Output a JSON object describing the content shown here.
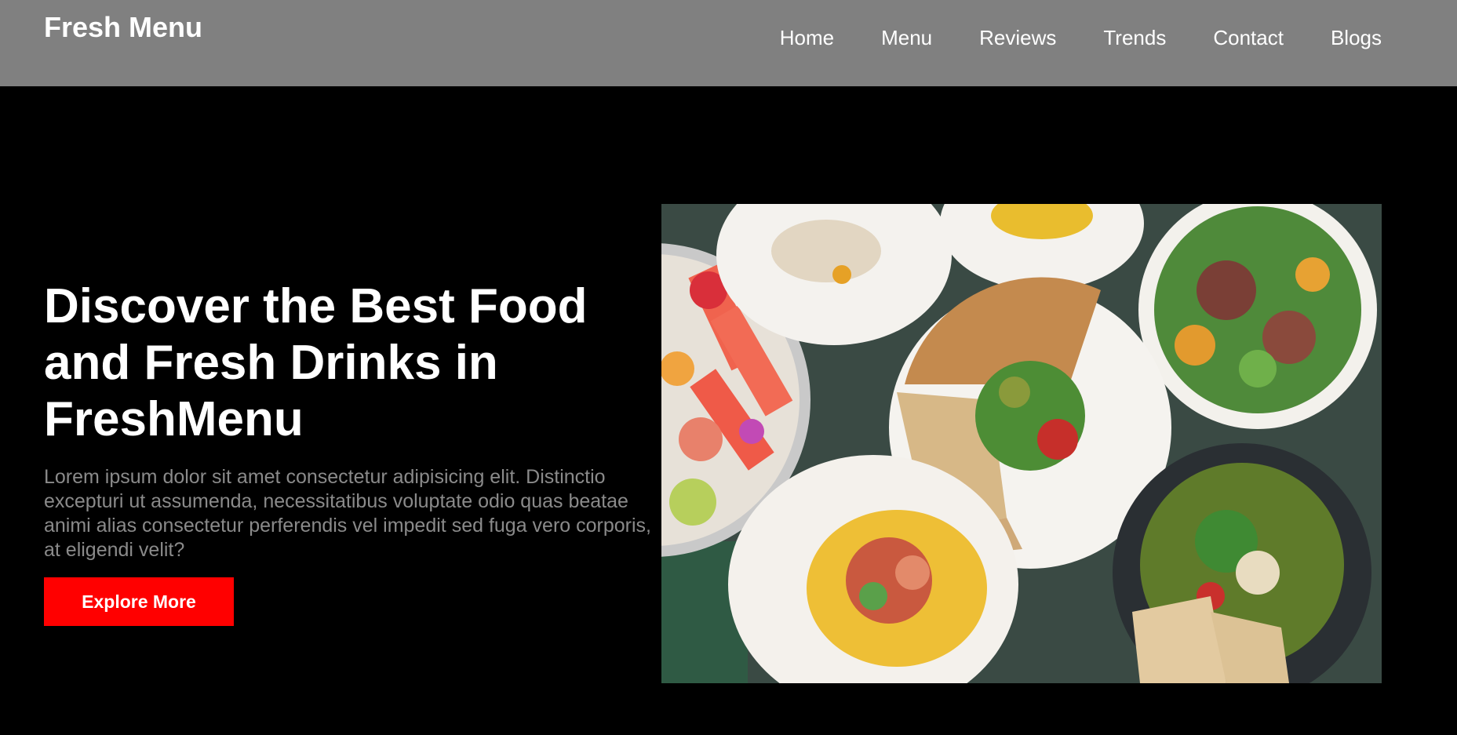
{
  "brand": {
    "name": "Fresh Menu"
  },
  "nav": {
    "items": [
      {
        "label": "Home"
      },
      {
        "label": "Menu"
      },
      {
        "label": "Reviews"
      },
      {
        "label": "Trends"
      },
      {
        "label": "Contact"
      },
      {
        "label": "Blogs"
      }
    ]
  },
  "hero": {
    "title": "Discover the Best Food and Fresh Drinks in FreshMenu",
    "description": "Lorem ipsum dolor sit amet consectetur adipisicing elit. Distinctio excepturi ut assumenda, necessitatibus voluptate odio quas beatae animi alias consectetur perferendis vel impedit sed fuga vero corporis, at eligendi velit?",
    "button_label": "Explore More"
  },
  "colors": {
    "navbar_bg": "#808080",
    "page_bg": "#000000",
    "accent": "#ff0000",
    "body_text": "#8a8a8a"
  }
}
